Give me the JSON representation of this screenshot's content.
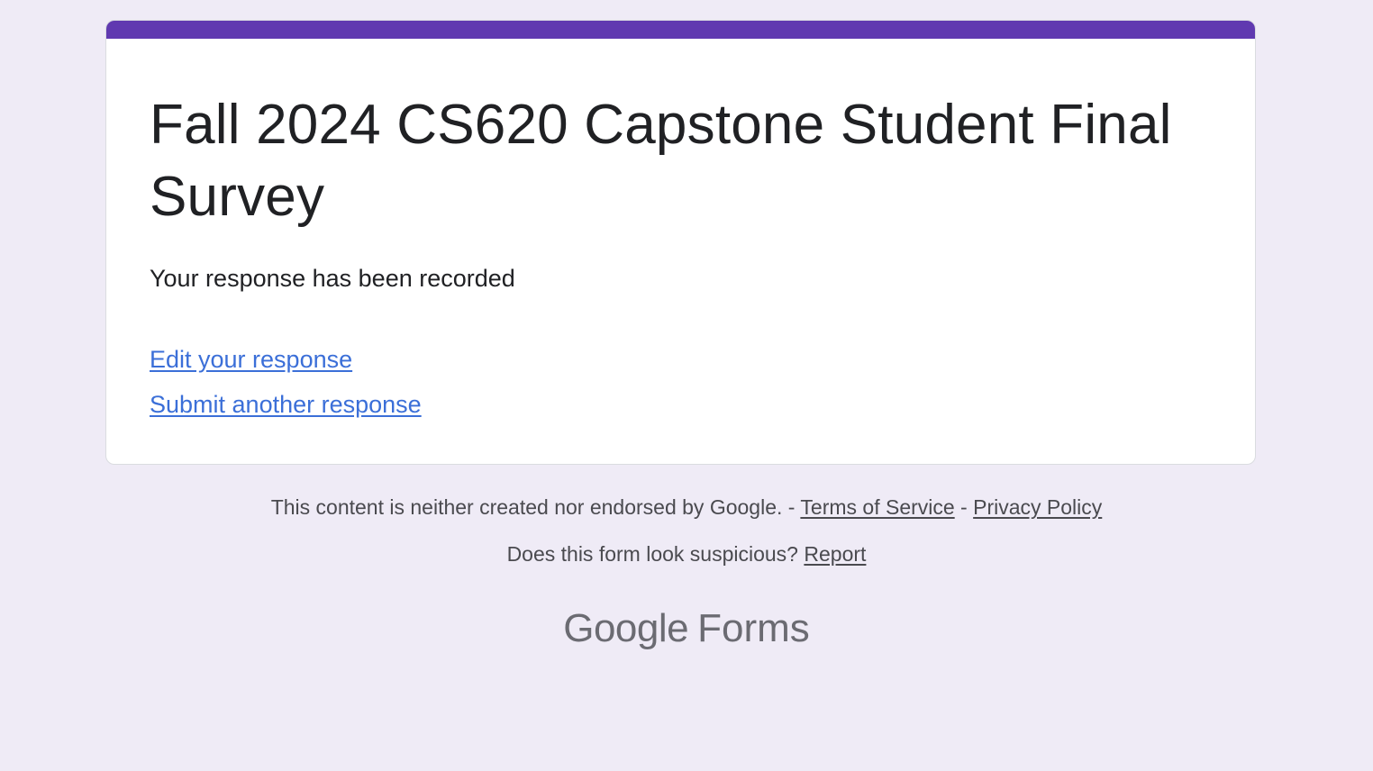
{
  "form": {
    "title": "Fall 2024 CS620 Capstone Student Final Survey",
    "confirmation": "Your response has been recorded",
    "edit_link": "Edit your response",
    "another_link": "Submit another response"
  },
  "footer": {
    "disclaimer": "This content is neither created nor endorsed by Google.",
    "sep1": " - ",
    "terms": "Terms of Service",
    "sep2": " - ",
    "privacy": "Privacy Policy",
    "suspicious": "Does this form look suspicious?",
    "report": "Report"
  },
  "logo": {
    "google": "Google",
    "forms": "Forms"
  },
  "colors": {
    "accent": "#6039b0",
    "background": "#efebf6",
    "link": "#3b6fd8"
  }
}
